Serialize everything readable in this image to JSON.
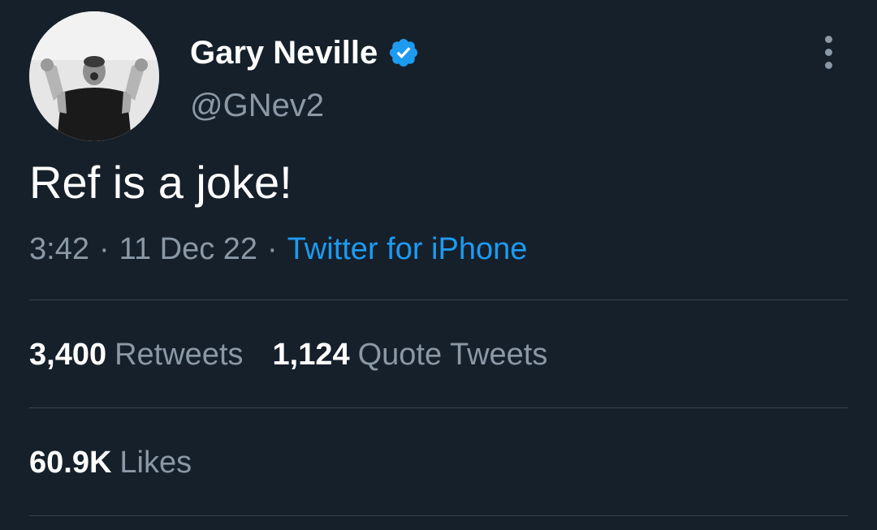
{
  "user": {
    "display_name": "Gary Neville",
    "handle": "@GNev2",
    "verified": true,
    "avatar_icon": "profile-photo",
    "verified_icon": "verified-badge-icon",
    "verified_color": "#1d9bf0"
  },
  "tweet": {
    "text": "Ref is a joke!",
    "time": "3:42",
    "date": "11 Dec 22",
    "separator": "·",
    "source": "Twitter for iPhone"
  },
  "stats": {
    "retweets": {
      "count": "3,400",
      "label": "Retweets"
    },
    "quote_tweets": {
      "count": "1,124",
      "label": "Quote Tweets"
    },
    "likes": {
      "count": "60.9K",
      "label": "Likes"
    }
  },
  "colors": {
    "background": "#15202b",
    "text_primary": "#ffffff",
    "text_secondary": "#8b98a5",
    "accent": "#1d9bf0",
    "divider": "#38444d"
  },
  "menu": {
    "icon": "more-vertical-icon"
  }
}
